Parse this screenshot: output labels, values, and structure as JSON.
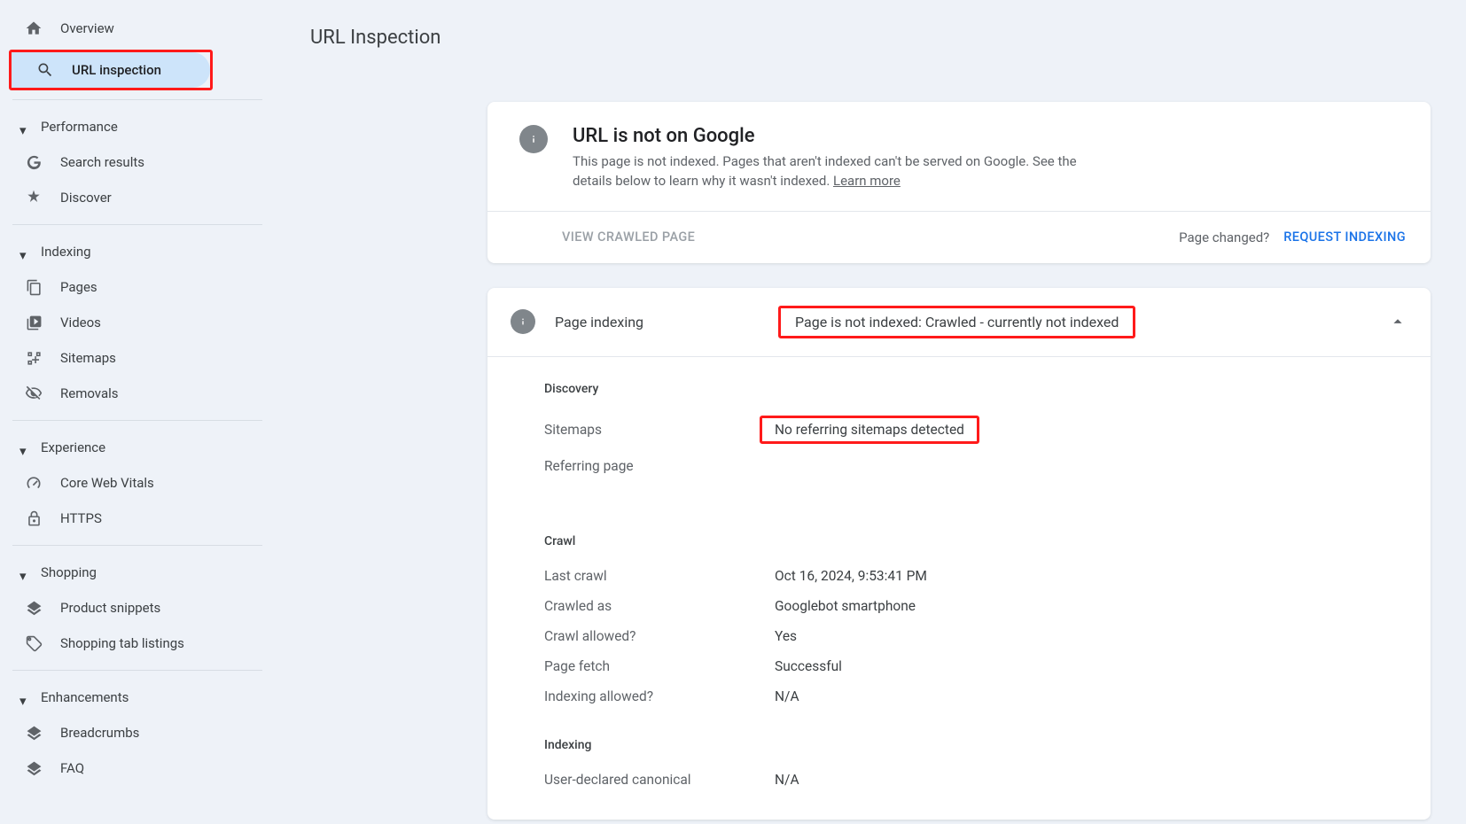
{
  "sidebar": {
    "overview": "Overview",
    "url_inspection": "URL inspection",
    "sections": {
      "performance": "Performance",
      "indexing": "Indexing",
      "experience": "Experience",
      "shopping": "Shopping",
      "enhancements": "Enhancements"
    },
    "items": {
      "search_results": "Search results",
      "discover": "Discover",
      "pages": "Pages",
      "videos": "Videos",
      "sitemaps": "Sitemaps",
      "removals": "Removals",
      "core_web_vitals": "Core Web Vitals",
      "https": "HTTPS",
      "product_snippets": "Product snippets",
      "shopping_tab": "Shopping tab listings",
      "breadcrumbs": "Breadcrumbs",
      "faq": "FAQ"
    }
  },
  "page": {
    "title": "URL Inspection"
  },
  "status_card": {
    "heading": "URL is not on Google",
    "desc": "This page is not indexed. Pages that aren't indexed can't be served on Google. See the details below to learn why it wasn't indexed. ",
    "learn_more": "Learn more",
    "view_crawled": "VIEW CRAWLED PAGE",
    "page_changed": "Page changed?",
    "request_indexing": "REQUEST INDEXING"
  },
  "indexing": {
    "title": "Page indexing",
    "status": "Page is not indexed: Crawled - currently not indexed",
    "discovery": {
      "label": "Discovery",
      "sitemaps_k": "Sitemaps",
      "sitemaps_v": "No referring sitemaps detected",
      "referring_k": "Referring page"
    },
    "crawl": {
      "label": "Crawl",
      "last_crawl_k": "Last crawl",
      "last_crawl_v": "Oct 16, 2024, 9:53:41 PM",
      "crawled_as_k": "Crawled as",
      "crawled_as_v": "Googlebot smartphone",
      "crawl_allowed_k": "Crawl allowed?",
      "crawl_allowed_v": "Yes",
      "page_fetch_k": "Page fetch",
      "page_fetch_v": "Successful",
      "indexing_allowed_k": "Indexing allowed?",
      "indexing_allowed_v": "N/A"
    },
    "indexing_sec": {
      "label": "Indexing",
      "canonical_k": "User-declared canonical",
      "canonical_v": "N/A"
    }
  }
}
